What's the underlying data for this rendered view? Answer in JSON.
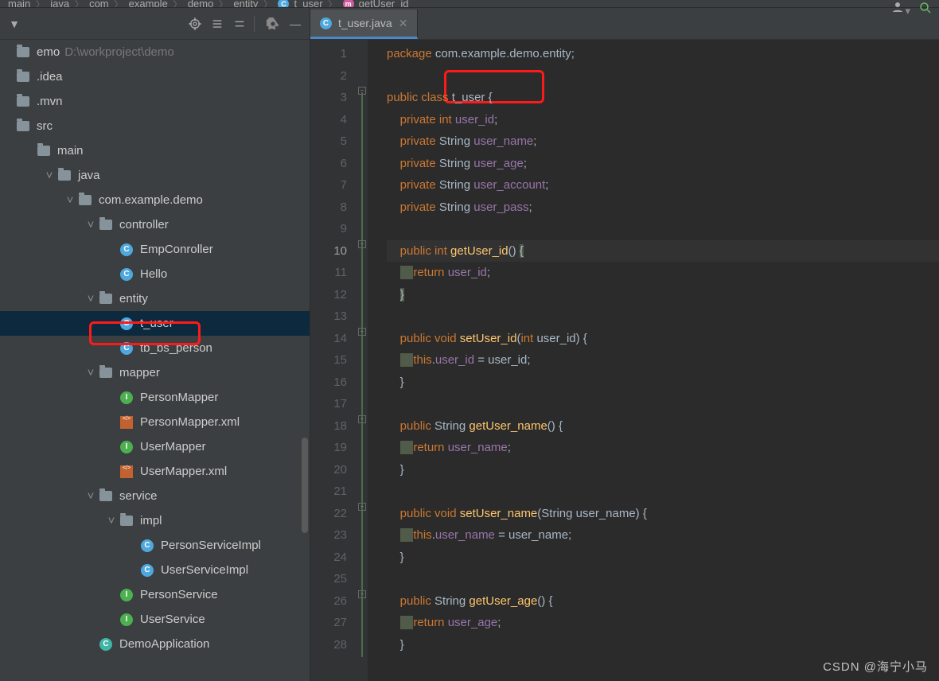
{
  "breadcrumb": [
    "main",
    "java",
    "com",
    "example",
    "demo",
    "entity",
    "t_user",
    "getUser_id"
  ],
  "project": {
    "name": "emo",
    "path": "D:\\workproject\\demo"
  },
  "tree": [
    {
      "indent": 0,
      "chev": "",
      "icon": "project",
      "label": "emo",
      "extra": " D:\\workproject\\demo",
      "sel": false
    },
    {
      "indent": 0,
      "chev": "",
      "icon": "folder",
      "label": ".idea",
      "sel": false
    },
    {
      "indent": 0,
      "chev": "",
      "icon": "folder",
      "label": ".mvn",
      "sel": false
    },
    {
      "indent": 0,
      "chev": "",
      "icon": "folder",
      "label": "src",
      "sel": false
    },
    {
      "indent": 1,
      "chev": "",
      "icon": "folder",
      "label": "main",
      "sel": false
    },
    {
      "indent": 2,
      "chev": "v",
      "icon": "folder",
      "label": "java",
      "sel": false
    },
    {
      "indent": 3,
      "chev": "v",
      "icon": "folder",
      "label": "com.example.demo",
      "sel": false
    },
    {
      "indent": 4,
      "chev": "v",
      "icon": "folder",
      "label": "controller",
      "sel": false
    },
    {
      "indent": 5,
      "chev": "",
      "icon": "c",
      "label": "EmpConroller",
      "sel": false
    },
    {
      "indent": 5,
      "chev": "",
      "icon": "c",
      "label": "Hello",
      "sel": false
    },
    {
      "indent": 4,
      "chev": "v",
      "icon": "folder",
      "label": "entity",
      "sel": false
    },
    {
      "indent": 5,
      "chev": "",
      "icon": "c",
      "label": "t_user",
      "sel": true
    },
    {
      "indent": 5,
      "chev": "",
      "icon": "c",
      "label": "tb_bs_person",
      "sel": false
    },
    {
      "indent": 4,
      "chev": "v",
      "icon": "folder",
      "label": "mapper",
      "sel": false
    },
    {
      "indent": 5,
      "chev": "",
      "icon": "i",
      "label": "PersonMapper",
      "sel": false
    },
    {
      "indent": 5,
      "chev": "",
      "icon": "xml",
      "label": "PersonMapper.xml",
      "sel": false
    },
    {
      "indent": 5,
      "chev": "",
      "icon": "i",
      "label": "UserMapper",
      "sel": false
    },
    {
      "indent": 5,
      "chev": "",
      "icon": "xml",
      "label": "UserMapper.xml",
      "sel": false
    },
    {
      "indent": 4,
      "chev": "v",
      "icon": "folder",
      "label": "service",
      "sel": false
    },
    {
      "indent": 5,
      "chev": "v",
      "icon": "folder",
      "label": "impl",
      "sel": false
    },
    {
      "indent": 6,
      "chev": "",
      "icon": "c",
      "label": "PersonServiceImpl",
      "sel": false
    },
    {
      "indent": 6,
      "chev": "",
      "icon": "c",
      "label": "UserServiceImpl",
      "sel": false
    },
    {
      "indent": 5,
      "chev": "",
      "icon": "i",
      "label": "PersonService",
      "sel": false
    },
    {
      "indent": 5,
      "chev": "",
      "icon": "i",
      "label": "UserService",
      "sel": false
    },
    {
      "indent": 4,
      "chev": "",
      "icon": "cg",
      "label": "DemoApplication",
      "sel": false
    }
  ],
  "tab": {
    "name": "t_user.java"
  },
  "line_count": 28,
  "code": [
    {
      "html": "<span class='kw'>package</span> com.example.demo.entity;"
    },
    {
      "html": ""
    },
    {
      "html": "<span class='kw'>public class</span> t_user {",
      "red": true
    },
    {
      "html": "    <span class='kw'>private int</span> <span class='ident'>user_id</span>;"
    },
    {
      "html": "    <span class='kw'>private</span> String <span class='ident'>user_name</span>;"
    },
    {
      "html": "    <span class='kw'>private</span> String <span class='ident'>user_age</span>;"
    },
    {
      "html": "    <span class='kw'>private</span> String <span class='ident'>user_account</span>;"
    },
    {
      "html": "    <span class='kw'>private</span> String <span class='ident'>user_pass</span>;"
    },
    {
      "html": ""
    },
    {
      "html": "    <span class='kw'>public int</span> <span class='fn'>getUser_id</span>() <span class='hl-gray'>{</span>",
      "current": true
    },
    {
      "html": "    <span class='hl-gray'>    </span><span class='kw'>return</span> <span class='ident'>user_id</span>;"
    },
    {
      "html": "    <span class='hl-gray'>}</span>"
    },
    {
      "html": ""
    },
    {
      "html": "    <span class='kw'>public void</span> <span class='fn'>setUser_id</span>(<span class='kw'>int</span> user_id) {"
    },
    {
      "html": "    <span class='hl-gray'>    </span><span class='kw'>this</span>.<span class='ident'>user_id</span> = user_id;"
    },
    {
      "html": "    }"
    },
    {
      "html": ""
    },
    {
      "html": "    <span class='kw'>public</span> String <span class='fn'>getUser_name</span>() {"
    },
    {
      "html": "    <span class='hl-gray'>    </span><span class='kw'>return</span> <span class='ident'>user_name</span>;"
    },
    {
      "html": "    }"
    },
    {
      "html": ""
    },
    {
      "html": "    <span class='kw'>public void</span> <span class='fn'>setUser_name</span>(String user_name) {"
    },
    {
      "html": "    <span class='hl-gray'>    </span><span class='kw'>this</span>.<span class='ident'>user_name</span> = user_name;"
    },
    {
      "html": "    }"
    },
    {
      "html": ""
    },
    {
      "html": "    <span class='kw'>public</span> String <span class='fn'>getUser_age</span>() {"
    },
    {
      "html": "    <span class='hl-gray'>    </span><span class='kw'>return</span> <span class='ident'>user_age</span>;"
    },
    {
      "html": "    }"
    }
  ],
  "watermark": "CSDN @海宁小马"
}
